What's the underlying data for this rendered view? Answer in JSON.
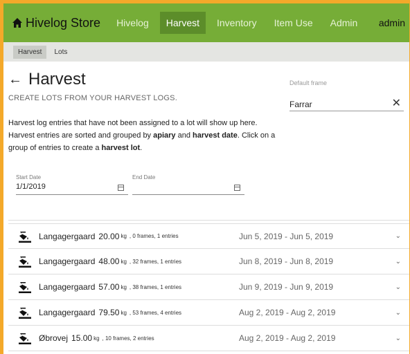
{
  "navbar": {
    "brand": "Hivelog Store",
    "links": [
      "Hivelog",
      "Harvest",
      "Inventory",
      "Item Use",
      "Admin"
    ],
    "active_index": 1,
    "user": "admin"
  },
  "subtabs": {
    "items": [
      "Harvest",
      "Lots"
    ],
    "active_index": 0
  },
  "header": {
    "title": "Harvest",
    "subtitle": "CREATE LOTS FROM YOUR HARVEST LOGS.",
    "frame_label": "Default frame",
    "frame_value": "Farrar"
  },
  "description": {
    "line1": "Harvest log entries that have not been assigned to a lot will show up here.",
    "line2_pre": "Harvest entries are sorted and grouped by ",
    "line2_b1": "apiary",
    "line2_mid": " and ",
    "line2_b2": "harvest date",
    "line2_post": ". Click on a",
    "line3_pre": "group of entries to create a ",
    "line3_b": "harvest lot",
    "line3_post": "."
  },
  "filters": {
    "start_label": "Start Date",
    "start_value": "1/1/2019",
    "end_label": "End Date",
    "end_value": ""
  },
  "harvests": [
    {
      "apiary": "Langagergaard",
      "weight": "20.00",
      "unit": "kg",
      "details": ", 0 frames, 1 entries",
      "dates": "Jun 5, 2019 - Jun 5, 2019"
    },
    {
      "apiary": "Langagergaard",
      "weight": "48.00",
      "unit": "kg",
      "details": ", 32 frames, 1 entries",
      "dates": "Jun 8, 2019 - Jun 8, 2019"
    },
    {
      "apiary": "Langagergaard",
      "weight": "57.00",
      "unit": "kg",
      "details": ", 38 frames, 1 entries",
      "dates": "Jun 9, 2019 - Jun 9, 2019"
    },
    {
      "apiary": "Langagergaard",
      "weight": "79.50",
      "unit": "kg",
      "details": ", 53 frames, 4 entries",
      "dates": "Aug 2, 2019 - Aug 2, 2019"
    },
    {
      "apiary": "Øbrovej",
      "weight": "15.00",
      "unit": "kg",
      "details": ", 10 frames, 2 entries",
      "dates": "Aug 2, 2019 - Aug 2, 2019"
    }
  ],
  "icons": {
    "home": "home-icon",
    "back": "back-arrow-icon",
    "clear": "close-icon",
    "calendar": "calendar-icon",
    "row": "paint-bucket-icon",
    "expand": "chevron-down-icon"
  },
  "colors": {
    "navbar": "#76ad37",
    "navbar_active": "#5c8d2a",
    "border": "#f4a92a"
  }
}
